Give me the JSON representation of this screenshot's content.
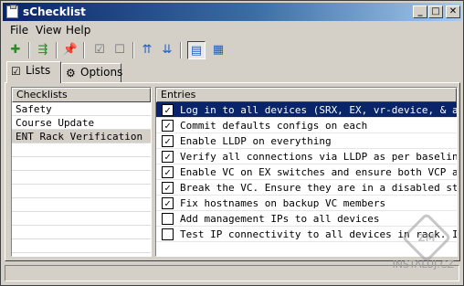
{
  "window": {
    "title": "sChecklist"
  },
  "menu": {
    "items": [
      "File",
      "View",
      "Help"
    ]
  },
  "toolbar": {
    "icons": [
      "new-list-icon",
      "move-icon",
      "pin-icon",
      "check-all-icon",
      "uncheck-all-icon",
      "move-up-icon",
      "move-down-icon",
      "detail-view-icon",
      "list-view-icon"
    ]
  },
  "tabs": [
    {
      "label": "Lists"
    },
    {
      "label": "Options"
    }
  ],
  "checklists": {
    "header": "Checklists",
    "items": [
      "Safety",
      "Course Update",
      "ENT Rack Verification"
    ]
  },
  "entries": {
    "header": "Entries",
    "items": [
      {
        "text": "Log in to all devices (SRX, EX, vr-device, & as-swi",
        "checked": true
      },
      {
        "text": "Commit defaults configs on each",
        "checked": true
      },
      {
        "text": "Enable LLDP on everything",
        "checked": true
      },
      {
        "text": "Verify all connections via LLDP as per baseline sno",
        "checked": true
      },
      {
        "text": "Enable VC on EX switches and ensure both VCP are up",
        "checked": true
      },
      {
        "text": "Break the VC.  Ensure they are in a disabled state",
        "checked": true
      },
      {
        "text": "Fix hostnames on backup VC members",
        "checked": true
      },
      {
        "text": "Add management IPs to all devices",
        "checked": false
      },
      {
        "text": "Test IP connectivity to all devices in rack.  Inclu",
        "checked": false
      }
    ]
  },
  "watermark": {
    "text": "INSTALUJ.CZ"
  }
}
